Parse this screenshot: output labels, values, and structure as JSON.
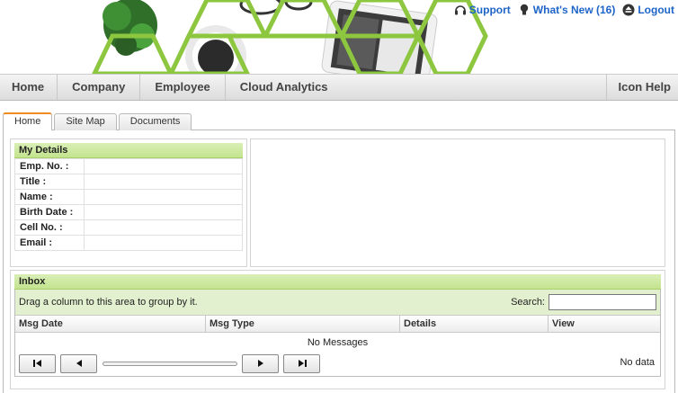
{
  "header": {
    "links": [
      {
        "label": "Support",
        "icon": "headset-icon"
      },
      {
        "label": "What's New (16)",
        "icon": "lightbulb-icon"
      },
      {
        "label": "Logout",
        "icon": "eject-icon"
      }
    ]
  },
  "nav": {
    "items": [
      "Home",
      "Company",
      "Employee",
      "Cloud Analytics"
    ],
    "right_item": "Icon Help"
  },
  "tabs": [
    {
      "label": "Home",
      "active": true
    },
    {
      "label": "Site Map",
      "active": false
    },
    {
      "label": "Documents",
      "active": false
    }
  ],
  "my_details": {
    "title": "My Details",
    "fields": [
      {
        "label": "Emp. No. :",
        "value": ""
      },
      {
        "label": "Title :",
        "value": ""
      },
      {
        "label": "Name :",
        "value": ""
      },
      {
        "label": "Birth Date :",
        "value": ""
      },
      {
        "label": "Cell No. :",
        "value": ""
      },
      {
        "label": "Email :",
        "value": ""
      }
    ]
  },
  "inbox": {
    "title": "Inbox",
    "group_hint": "Drag a column to this area to group by it.",
    "search_label": "Search:",
    "search_value": "",
    "columns": [
      "Msg Date",
      "Msg Type",
      "Details",
      "View"
    ],
    "empty_text": "No Messages",
    "pager_status": "No data"
  },
  "colors": {
    "link": "#1e64c8",
    "accent_green": "#8dc63f",
    "panel_header": "#c4e48e",
    "active_tab_border": "#f08a24"
  }
}
